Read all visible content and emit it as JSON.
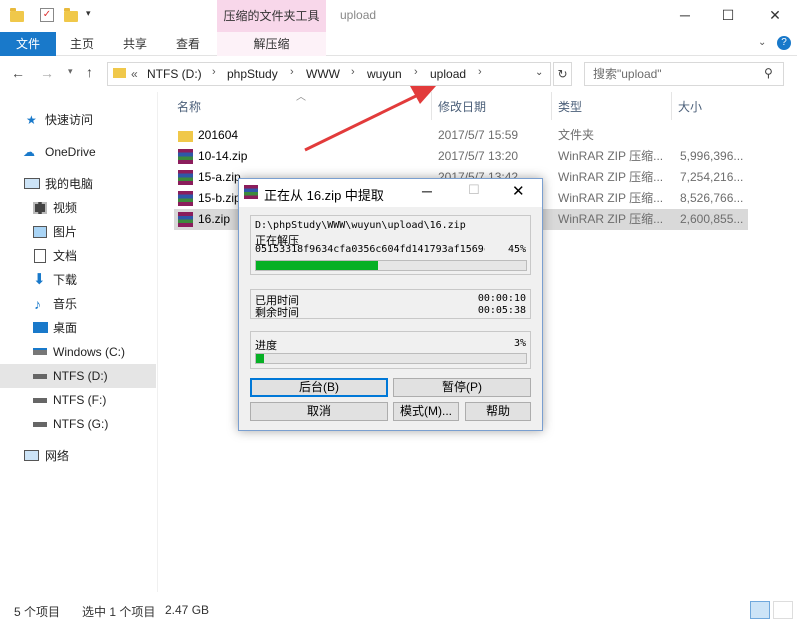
{
  "window": {
    "context_tab": "压缩的文件夹工具",
    "title": "upload"
  },
  "ribbon": {
    "file": "文件",
    "tabs": [
      "主页",
      "共享",
      "查看"
    ],
    "context_sub": "解压缩"
  },
  "address": {
    "overflow": "«",
    "crumbs": [
      "NTFS (D:)",
      "phpStudy",
      "WWW",
      "wuyun",
      "upload"
    ],
    "search_placeholder": "搜索\"upload\""
  },
  "nav": {
    "items": [
      {
        "label": "快速访问",
        "icon": "star-icon"
      },
      {
        "label": "OneDrive",
        "icon": "cloud-icon"
      },
      {
        "label": "我的电脑",
        "icon": "computer-icon"
      },
      {
        "label": "视频",
        "icon": "video-icon"
      },
      {
        "label": "图片",
        "icon": "pictures-icon"
      },
      {
        "label": "文档",
        "icon": "documents-icon"
      },
      {
        "label": "下载",
        "icon": "download-icon"
      },
      {
        "label": "音乐",
        "icon": "music-icon"
      },
      {
        "label": "桌面",
        "icon": "desktop-icon"
      },
      {
        "label": "Windows (C:)",
        "icon": "drive-icon"
      },
      {
        "label": "NTFS (D:)",
        "icon": "drive-icon"
      },
      {
        "label": "NTFS (F:)",
        "icon": "drive-icon"
      },
      {
        "label": "NTFS (G:)",
        "icon": "drive-icon"
      },
      {
        "label": "网络",
        "icon": "network-icon"
      }
    ]
  },
  "columns": {
    "name": "名称",
    "date": "修改日期",
    "type": "类型",
    "size": "大小"
  },
  "files": [
    {
      "name": "201604",
      "date": "2017/5/7 15:59",
      "type": "文件夹",
      "size": "",
      "icon": "folder-icon"
    },
    {
      "name": "10-14.zip",
      "date": "2017/5/7 13:20",
      "type": "WinRAR ZIP 压缩...",
      "size": "5,996,396...",
      "icon": "winrar-icon"
    },
    {
      "name": "15-a.zip",
      "date": "2017/5/7 13:42",
      "type": "WinRAR ZIP 压缩...",
      "size": "7,254,216...",
      "icon": "winrar-icon"
    },
    {
      "name": "15-b.zip",
      "date": "",
      "type": "WinRAR ZIP 压缩...",
      "size": "8,526,766...",
      "icon": "winrar-icon"
    },
    {
      "name": "16.zip",
      "date": "",
      "type": "WinRAR ZIP 压缩...",
      "size": "2,600,855...",
      "icon": "winrar-icon"
    }
  ],
  "status": {
    "count": "5 个项目",
    "selected": "选中 1 个项目",
    "size": "2.47 GB"
  },
  "dialog": {
    "title": "正在从 16.zip 中提取",
    "path": "D:\\phpStudy\\WWW\\wuyun\\upload\\16.zip",
    "action": "正在解压",
    "file": "05153318f9634cfa0356c604fd141793af1569c",
    "file_percent": "45%",
    "file_progress": 0.45,
    "elapsed_label": "已用时间",
    "elapsed": "00:00:10",
    "remaining_label": "剩余时间",
    "remaining": "00:05:38",
    "total_label": "进度",
    "total_percent": "3%",
    "total_progress": 0.03,
    "buttons": {
      "background": "后台(B)",
      "pause": "暂停(P)",
      "cancel": "取消",
      "mode": "模式(M)...",
      "help": "帮助"
    }
  }
}
